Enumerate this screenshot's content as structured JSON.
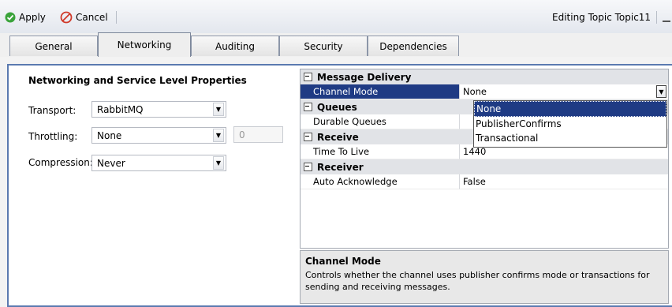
{
  "toolbar": {
    "apply_label": "Apply",
    "cancel_label": "Cancel",
    "editing_text": "Editing Topic Topic11"
  },
  "tabs": [
    {
      "label": "General"
    },
    {
      "label": "Networking",
      "active": true
    },
    {
      "label": "Auditing"
    },
    {
      "label": "Security"
    },
    {
      "label": "Dependencies"
    }
  ],
  "networking": {
    "heading": "Networking and Service Level Properties",
    "transport_label": "Transport:",
    "transport_value": "RabbitMQ",
    "throttling_label": "Throttling:",
    "throttling_value": "None",
    "throttling_number": "0",
    "compression_label": "Compression:",
    "compression_value": "Never"
  },
  "property_grid": {
    "categories": [
      {
        "name": "Message Delivery",
        "rows": [
          {
            "name": "Channel Mode",
            "value": "None"
          }
        ]
      },
      {
        "name": "Queues",
        "rows": [
          {
            "name": "Durable Queues",
            "value": ""
          }
        ]
      },
      {
        "name": "Receive",
        "rows": [
          {
            "name": "Time To Live",
            "value": "1440"
          }
        ]
      },
      {
        "name": "Receiver",
        "rows": [
          {
            "name": "Auto Acknowledge",
            "value": "False"
          }
        ]
      }
    ],
    "dropdown_options": [
      "None",
      "PublisherConfirms",
      "Transactional"
    ],
    "selected_option": "None"
  },
  "description": {
    "title": "Channel Mode",
    "text": "Controls whether the channel uses publisher confirms mode or transactions for sending and receiving messages."
  },
  "colors": {
    "accent": "#1f3b84",
    "frame_border": "#5b7ab0",
    "apply_icon": "#3aa33a",
    "cancel_icon": "#d03a2a"
  }
}
